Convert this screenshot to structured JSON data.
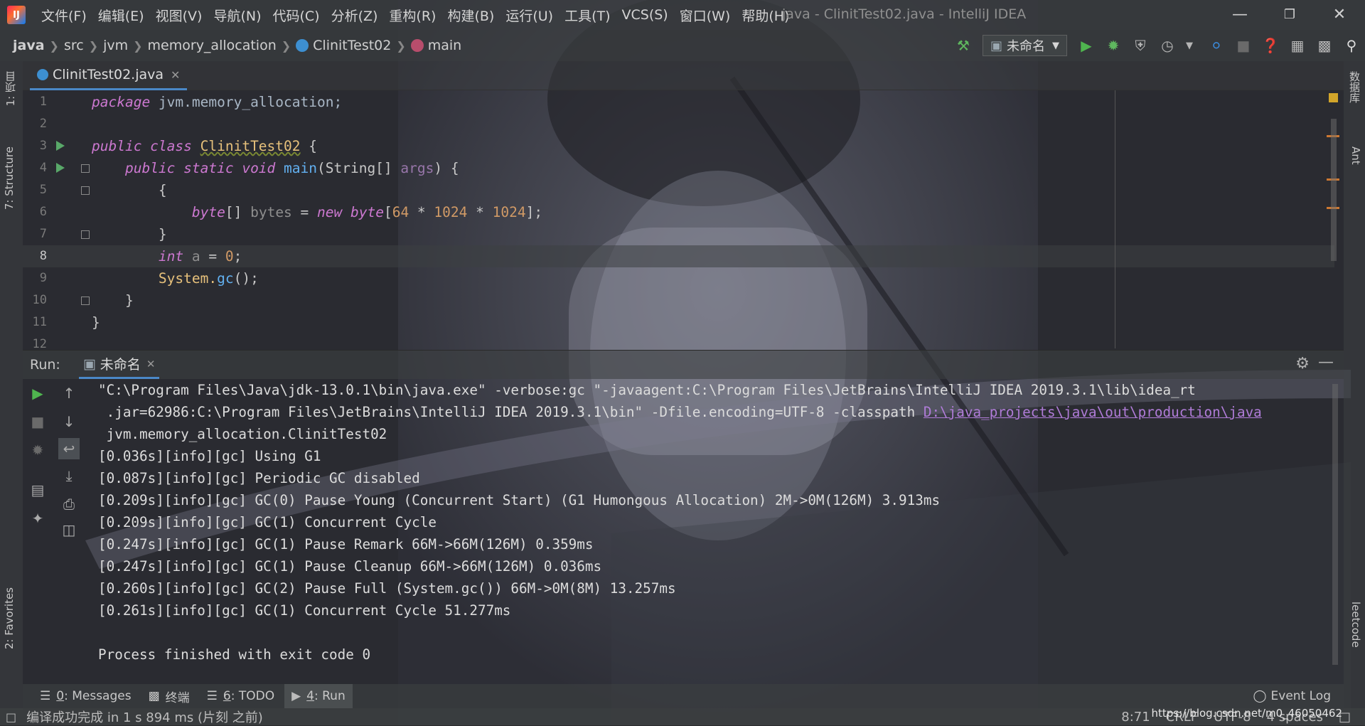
{
  "window": {
    "title": "java - ClinitTest02.java - IntelliJ IDEA",
    "menu": [
      "文件(F)",
      "编辑(E)",
      "视图(V)",
      "导航(N)",
      "代码(C)",
      "分析(Z)",
      "重构(R)",
      "构建(B)",
      "运行(U)",
      "工具(T)",
      "VCS(S)",
      "窗口(W)",
      "帮助(H)"
    ]
  },
  "breadcrumb": {
    "items": [
      "java",
      "src",
      "jvm",
      "memory_allocation",
      "ClinitTest02",
      "main"
    ]
  },
  "toolbar": {
    "run_config": "未命名"
  },
  "side_tabs": {
    "project": "1: 项目",
    "structure": "7: Structure",
    "favorites": "2: Favorites",
    "database": "数据库",
    "ant": "Ant",
    "leetcode": "leetcode"
  },
  "editor": {
    "tab_label": "ClinitTest02.java",
    "current_line": 8,
    "lines": [
      {
        "n": "1"
      },
      {
        "n": "2"
      },
      {
        "n": "3"
      },
      {
        "n": "4"
      },
      {
        "n": "5"
      },
      {
        "n": "6"
      },
      {
        "n": "7"
      },
      {
        "n": "8"
      },
      {
        "n": "9"
      },
      {
        "n": "10"
      },
      {
        "n": "11"
      },
      {
        "n": "12"
      }
    ],
    "code": {
      "l1_kw": "package",
      "l1_rest": " jvm.memory_allocation;",
      "l3_kw": "public class ",
      "l3_cls": "ClinitTest02",
      "l3_rest": " {",
      "l4_kw": "public static void ",
      "l4_fn": "main",
      "l4_rest1": "(String[] ",
      "l4_var": "args",
      "l4_rest2": ") {",
      "l5": "{",
      "l6_kw": "byte",
      "l6_a": "[] ",
      "l6_var": "bytes",
      "l6_b": " = ",
      "l6_kw2": "new byte",
      "l6_c": "[",
      "l6_n1": "64",
      "l6_d": " * ",
      "l6_n2": "1024",
      "l6_e": " * ",
      "l6_n3": "1024",
      "l6_f": "];",
      "l7": "}",
      "l8_kw": "int",
      "l8_var": " a",
      "l8_a": " = ",
      "l8_n": "0",
      "l8_b": ";",
      "l9_a": "System.",
      "l9_fn": "gc",
      "l9_b": "();",
      "l10": "}",
      "l11": "}"
    }
  },
  "run_panel": {
    "label": "Run:",
    "tab": "未命名",
    "console": [
      "\"C:\\Program Files\\Java\\jdk-13.0.1\\bin\\java.exe\" -verbose:gc \"-javaagent:C:\\Program Files\\JetBrains\\IntelliJ IDEA 2019.3.1\\lib\\idea_rt",
      " .jar=62986:C:\\Program Files\\JetBrains\\IntelliJ IDEA 2019.3.1\\bin\" -Dfile.encoding=UTF-8 -classpath ",
      " jvm.memory_allocation.ClinitTest02",
      "[0.036s][info][gc] Using G1",
      "[0.087s][info][gc] Periodic GC disabled",
      "[0.209s][info][gc] GC(0) Pause Young (Concurrent Start) (G1 Humongous Allocation) 2M->0M(126M) 3.913ms",
      "[0.209s][info][gc] GC(1) Concurrent Cycle",
      "[0.247s][info][gc] GC(1) Pause Remark 66M->66M(126M) 0.359ms",
      "[0.247s][info][gc] GC(1) Pause Cleanup 66M->66M(126M) 0.036ms",
      "[0.260s][info][gc] GC(2) Pause Full (System.gc()) 66M->0M(8M) 13.257ms",
      "[0.261s][info][gc] GC(1) Concurrent Cycle 51.277ms",
      "",
      "Process finished with exit code 0"
    ],
    "classpath_link": "D:\\java_projects\\java\\out\\production\\java"
  },
  "tool_windows": {
    "messages_num": "0",
    "messages": ": Messages",
    "terminal": "终端",
    "todo_num": "6",
    "todo": ": TODO",
    "run_num": "4",
    "run": ": Run",
    "event_log": "Event Log"
  },
  "status": {
    "message": "编译成功完成 in 1 s 894 ms (片刻 之前)",
    "position": "8:71",
    "line_sep": "CRLF",
    "encoding": "UTF-8",
    "indent": "4 spaces",
    "watermark": "https://blog.csdn.net/m0_46050462"
  },
  "colors": {
    "accent": "#4a88c7",
    "keyword": "#cc7832",
    "number": "#6897bb",
    "run_green": "#59a869",
    "link": "#b07cd8"
  }
}
